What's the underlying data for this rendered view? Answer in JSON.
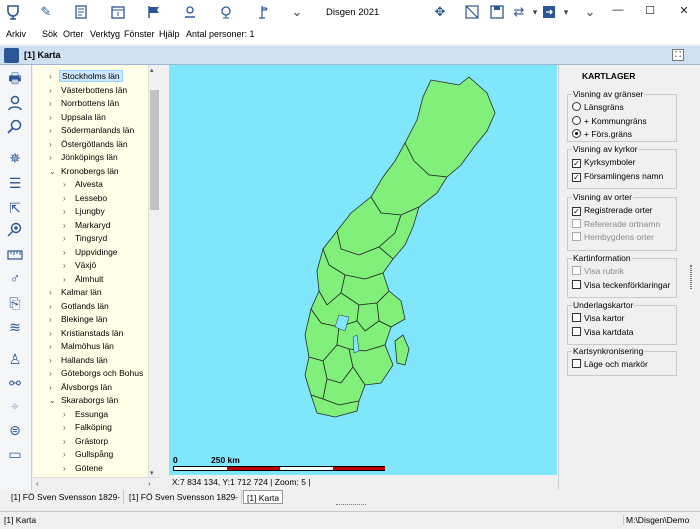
{
  "app": {
    "title": "Disgen 2021"
  },
  "window_controls": {
    "minimize": "—",
    "maximize": "☐",
    "close": "✕"
  },
  "menu": {
    "items": [
      "Arkiv",
      "Sök",
      "Orter",
      "Verktyg",
      "Fönster",
      "Hjälp"
    ],
    "person_count": "Antal personer: 1"
  },
  "mdi": {
    "title": "[1] Karta"
  },
  "tree": {
    "items": [
      {
        "label": "Stockholms län",
        "level": 1,
        "expanded": false,
        "selected": true
      },
      {
        "label": "Västerbottens län",
        "level": 1,
        "expanded": false
      },
      {
        "label": "Norrbottens län",
        "level": 1,
        "expanded": false
      },
      {
        "label": "Uppsala län",
        "level": 1,
        "expanded": false
      },
      {
        "label": "Södermanlands län",
        "level": 1,
        "expanded": false
      },
      {
        "label": "Östergötlands län",
        "level": 1,
        "expanded": false
      },
      {
        "label": "Jönköpings län",
        "level": 1,
        "expanded": false
      },
      {
        "label": "Kronobergs län",
        "level": 1,
        "expanded": true
      },
      {
        "label": "Alvesta",
        "level": 2,
        "expanded": false
      },
      {
        "label": "Lessebo",
        "level": 2,
        "expanded": false
      },
      {
        "label": "Ljungby",
        "level": 2,
        "expanded": false
      },
      {
        "label": "Markaryd",
        "level": 2,
        "expanded": false
      },
      {
        "label": "Tingsryd",
        "level": 2,
        "expanded": false
      },
      {
        "label": "Uppvidinge",
        "level": 2,
        "expanded": false
      },
      {
        "label": "Växjö",
        "level": 2,
        "expanded": false
      },
      {
        "label": "Älmhult",
        "level": 2,
        "expanded": false
      },
      {
        "label": "Kalmar län",
        "level": 1,
        "expanded": false
      },
      {
        "label": "Gotlands län",
        "level": 1,
        "expanded": false
      },
      {
        "label": "Blekinge län",
        "level": 1,
        "expanded": false
      },
      {
        "label": "Kristianstads län",
        "level": 1,
        "expanded": false
      },
      {
        "label": "Malmöhus län",
        "level": 1,
        "expanded": false
      },
      {
        "label": "Hallands län",
        "level": 1,
        "expanded": false
      },
      {
        "label": "Göteborgs och Bohus",
        "level": 1,
        "expanded": false
      },
      {
        "label": "Älvsborgs län",
        "level": 1,
        "expanded": false
      },
      {
        "label": "Skaraborgs län",
        "level": 1,
        "expanded": true
      },
      {
        "label": "Essunga",
        "level": 2,
        "expanded": false
      },
      {
        "label": "Falköping",
        "level": 2,
        "expanded": false
      },
      {
        "label": "Grästorp",
        "level": 2,
        "expanded": false
      },
      {
        "label": "Gullspång",
        "level": 2,
        "expanded": false
      },
      {
        "label": "Götene",
        "level": 2,
        "expanded": false
      }
    ]
  },
  "map": {
    "scale_start": "0",
    "scale_label": "250 km",
    "coords": "X:7 834 134, Y:1 712 724",
    "zoom": "Zoom: 5",
    "water_color": "#7fe6fb",
    "land_color": "#80f07a"
  },
  "panel": {
    "title": "KARTLAGER",
    "groups": [
      {
        "title": "Visning av gränser",
        "type": "radio",
        "options": [
          {
            "label": "Länsgräns",
            "checked": false,
            "disabled": false
          },
          {
            "label": "+ Kommungräns",
            "checked": false,
            "disabled": false
          },
          {
            "label": "+ Förs.gräns",
            "checked": true,
            "disabled": false
          }
        ]
      },
      {
        "title": "Visning av kyrkor",
        "type": "check",
        "options": [
          {
            "label": "Kyrksymboler",
            "checked": true,
            "disabled": false
          },
          {
            "label": "Församlingens namn",
            "checked": true,
            "disabled": false
          }
        ]
      },
      {
        "title": "Visning av orter",
        "type": "check",
        "options": [
          {
            "label": "Registrerade orter",
            "checked": true,
            "disabled": false
          },
          {
            "label": "Refererade ortnamn",
            "checked": false,
            "disabled": true
          },
          {
            "label": "Hembygdens orter",
            "checked": false,
            "disabled": true
          }
        ]
      },
      {
        "title": "Kartinformation",
        "type": "check",
        "options": [
          {
            "label": "Visa rubrik",
            "checked": false,
            "disabled": true
          },
          {
            "label": "Visa teckenförklaringar",
            "checked": false,
            "disabled": false
          }
        ]
      },
      {
        "title": "Underlagskartor",
        "type": "check",
        "options": [
          {
            "label": "Visa kartor",
            "checked": false,
            "disabled": false
          },
          {
            "label": "Visa kartdata",
            "checked": false,
            "disabled": false
          }
        ]
      },
      {
        "title": "Kartsynkronisering",
        "type": "check",
        "options": [
          {
            "label": "Läge och markör",
            "checked": false,
            "disabled": false
          }
        ]
      }
    ]
  },
  "tabs": [
    {
      "label": "[1] FÖ Sven Svensson 1829-",
      "active": false
    },
    {
      "label": "[1] FÖ Sven Svensson 1829-",
      "active": false
    },
    {
      "label": "[1] Karta",
      "active": true
    }
  ],
  "statusbar": {
    "left": "[1] Karta",
    "right": "M:\\Disgen\\Demo"
  }
}
